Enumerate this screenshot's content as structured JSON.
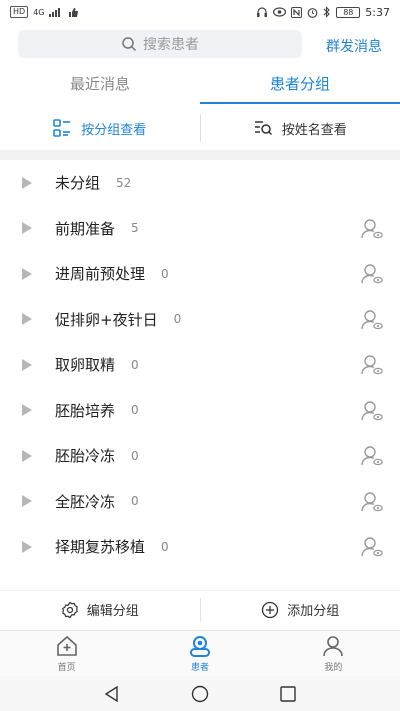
{
  "status_bar": {
    "network_chip": "HD",
    "signal_text": "4G",
    "battery": "88",
    "time": "5:37"
  },
  "header": {
    "search_placeholder": "搜索患者",
    "group_send": "群发消息"
  },
  "tabs": [
    {
      "label": "最近消息",
      "active": false
    },
    {
      "label": "患者分组",
      "active": true
    }
  ],
  "view_modes": [
    {
      "label": "按分组查看",
      "active": true
    },
    {
      "label": "按姓名查看",
      "active": false
    }
  ],
  "groups": [
    {
      "name": "未分组",
      "count": "52",
      "has_icon": false
    },
    {
      "name": "前期准备",
      "count": "5",
      "has_icon": true
    },
    {
      "name": "进周前预处理",
      "count": "0",
      "has_icon": true
    },
    {
      "name": "促排卵+夜针日",
      "count": "0",
      "has_icon": true
    },
    {
      "name": "取卵取精",
      "count": "0",
      "has_icon": true
    },
    {
      "name": "胚胎培养",
      "count": "0",
      "has_icon": true
    },
    {
      "name": "胚胎冷冻",
      "count": "0",
      "has_icon": true
    },
    {
      "name": "全胚冷冻",
      "count": "0",
      "has_icon": true
    },
    {
      "name": "择期复苏移植",
      "count": "0",
      "has_icon": true
    }
  ],
  "actions": {
    "edit_group": "编辑分组",
    "add_group": "添加分组"
  },
  "bottom_nav": [
    {
      "label": "首页",
      "icon": "home-icon",
      "active": false
    },
    {
      "label": "患者",
      "icon": "patient-icon",
      "active": true
    },
    {
      "label": "我的",
      "icon": "profile-icon",
      "active": false
    }
  ],
  "colors": {
    "accent": "#1f84d8",
    "text_primary": "#222222",
    "text_muted": "#888888",
    "caret": "#b7b7b7",
    "band": "#f2f2f2"
  }
}
